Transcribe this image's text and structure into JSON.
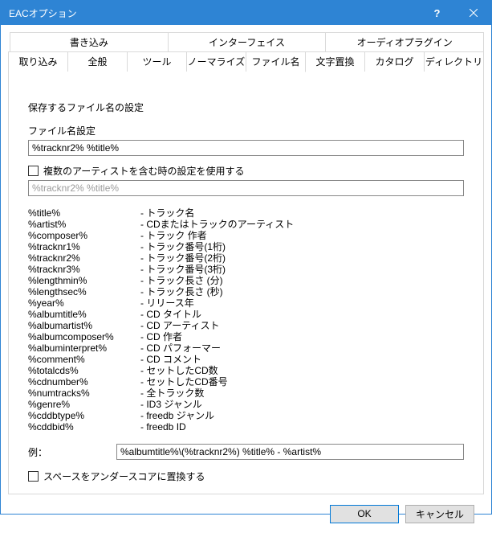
{
  "title": "EACオプション",
  "tabs_row1": [
    "書き込み",
    "インターフェイス",
    "オーディオプラグイン"
  ],
  "tabs_row2": [
    "取り込み",
    "全般",
    "ツール",
    "ノーマライズ",
    "ファイル名",
    "文字置換",
    "カタログ",
    "ディレクトリ"
  ],
  "active_tab": "ファイル名",
  "section": {
    "heading": "保存するファイル名の設定",
    "filename_label": "ファイル名設定",
    "filename_value": "%tracknr2% %title%",
    "multi_artist_checkbox": "複数のアーティストを含む時の設定を使用する",
    "multi_artist_value": "%tracknr2% %title%"
  },
  "variables": [
    {
      "key": "%title%",
      "desc": "- トラック名"
    },
    {
      "key": "%artist%",
      "desc": "- CDまたはトラックのアーティスト"
    },
    {
      "key": "%composer%",
      "desc": "- トラック 作者"
    },
    {
      "key": "%tracknr1%",
      "desc": "- トラック番号(1桁)"
    },
    {
      "key": "%tracknr2%",
      "desc": "- トラック番号(2桁)"
    },
    {
      "key": "%tracknr3%",
      "desc": "- トラック番号(3桁)"
    },
    {
      "key": "%lengthmin%",
      "desc": "- トラック長さ (分)"
    },
    {
      "key": "%lengthsec%",
      "desc": "- トラック長さ (秒)"
    },
    {
      "key": "%year%",
      "desc": "- リリース年"
    },
    {
      "key": "%albumtitle%",
      "desc": "- CD タイトル"
    },
    {
      "key": "%albumartist%",
      "desc": "- CD アーティスト"
    },
    {
      "key": "%albumcomposer%",
      "desc": "- CD 作者"
    },
    {
      "key": "%albuminterpret%",
      "desc": "- CD パフォーマー"
    },
    {
      "key": "%comment%",
      "desc": "- CD コメント"
    },
    {
      "key": "%totalcds%",
      "desc": "- セットしたCD数"
    },
    {
      "key": "%cdnumber%",
      "desc": "- セットしたCD番号"
    },
    {
      "key": "%numtracks%",
      "desc": "- 全トラック数"
    },
    {
      "key": "%genre%",
      "desc": "- ID3 ジャンル"
    },
    {
      "key": "%cddbtype%",
      "desc": "- freedb ジャンル"
    },
    {
      "key": "%cddbid%",
      "desc": "- freedb ID"
    }
  ],
  "example": {
    "label": "例：",
    "value": "%albumtitle%\\(%tracknr2%) %title% - %artist%"
  },
  "replace_spaces": "スペースをアンダースコアに置換する",
  "buttons": {
    "ok": "OK",
    "cancel": "キャンセル"
  }
}
